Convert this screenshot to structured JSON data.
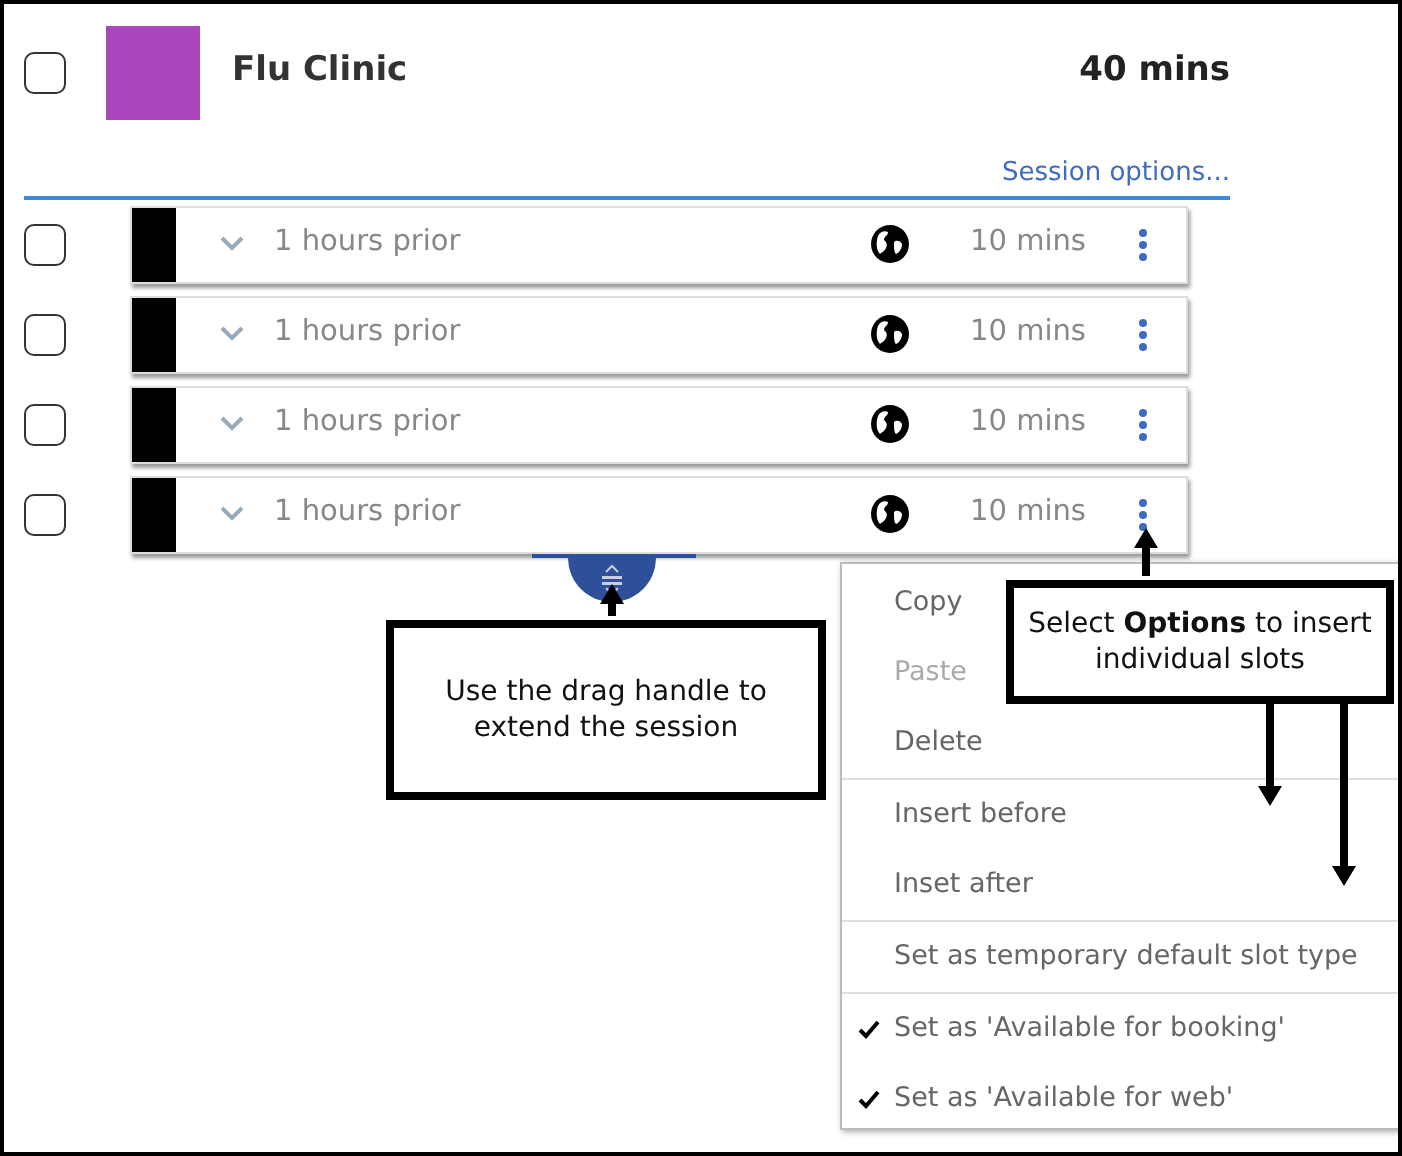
{
  "session": {
    "checked": false,
    "color": "#ab47bc",
    "title": "Flu Clinic",
    "duration": "40 mins",
    "options_link": "Session options..."
  },
  "slots": [
    {
      "checked": false,
      "color": "#000000",
      "label": "1 hours prior",
      "duration": "10 mins"
    },
    {
      "checked": false,
      "color": "#000000",
      "label": "1 hours prior",
      "duration": "10 mins"
    },
    {
      "checked": false,
      "color": "#000000",
      "label": "1 hours prior",
      "duration": "10 mins"
    },
    {
      "checked": false,
      "color": "#000000",
      "label": "1 hours prior",
      "duration": "10 mins"
    }
  ],
  "context_menu": {
    "groups": [
      [
        {
          "label": "Copy",
          "disabled": false,
          "checked": false
        },
        {
          "label": "Paste",
          "disabled": true,
          "checked": false
        },
        {
          "label": "Delete",
          "disabled": false,
          "checked": false
        }
      ],
      [
        {
          "label": "Insert before",
          "disabled": false,
          "checked": false
        },
        {
          "label": "Inset after",
          "disabled": false,
          "checked": false
        }
      ],
      [
        {
          "label": "Set as temporary default slot type",
          "disabled": false,
          "checked": false
        }
      ],
      [
        {
          "label": "Set as 'Available for booking'",
          "disabled": false,
          "checked": true
        },
        {
          "label": "Set as 'Available for web'",
          "disabled": false,
          "checked": true
        }
      ]
    ]
  },
  "callouts": [
    {
      "text": "Use the drag handle to extend the session"
    },
    {
      "text": "Select **Options** to insert individual slots"
    }
  ]
}
